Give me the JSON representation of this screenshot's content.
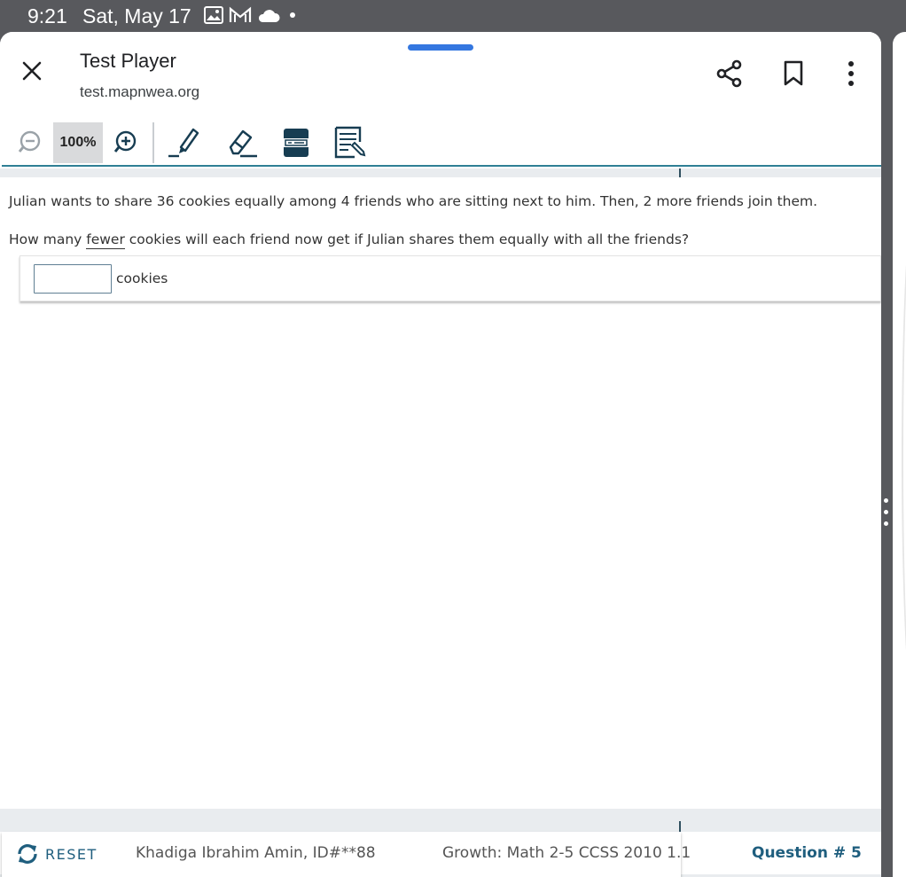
{
  "status_bar": {
    "time": "9:21",
    "date": "Sat, May 17",
    "icons": [
      "gallery-icon",
      "gmail-icon",
      "cloud-icon",
      "dot-indicator"
    ]
  },
  "browser": {
    "title": "Test Player",
    "url": "test.mapnwea.org",
    "actions": [
      "share-icon",
      "bookmark-icon",
      "more-icon"
    ]
  },
  "toolbar": {
    "zoom_level": "100%",
    "tools": [
      "zoom-out-icon",
      "zoom-in-icon",
      "highlighter-icon",
      "eraser-icon",
      "line-reader-icon",
      "notepad-icon"
    ]
  },
  "question": {
    "text_line1": "Julian wants to share 36 cookies equally among 4 friends who are sitting next to him. Then, 2 more friends join them.",
    "text_line2_before": "How many ",
    "text_line2_emphasis": "fewer",
    "text_line2_after": " cookies will each friend now get if Julian shares them equally with all the friends?",
    "answer_value": "",
    "answer_unit": "cookies"
  },
  "footer": {
    "reset_label": "RESET",
    "student": "Khadiga Ibrahim Amin, ID#**88",
    "test_name": "Growth: Math 2-5 CCSS 2010 1.1",
    "question_number": "Question # 5"
  },
  "colors": {
    "accent": "#1f5e7e",
    "rule": "#2f7f95",
    "drag_handle": "#3477e0"
  }
}
